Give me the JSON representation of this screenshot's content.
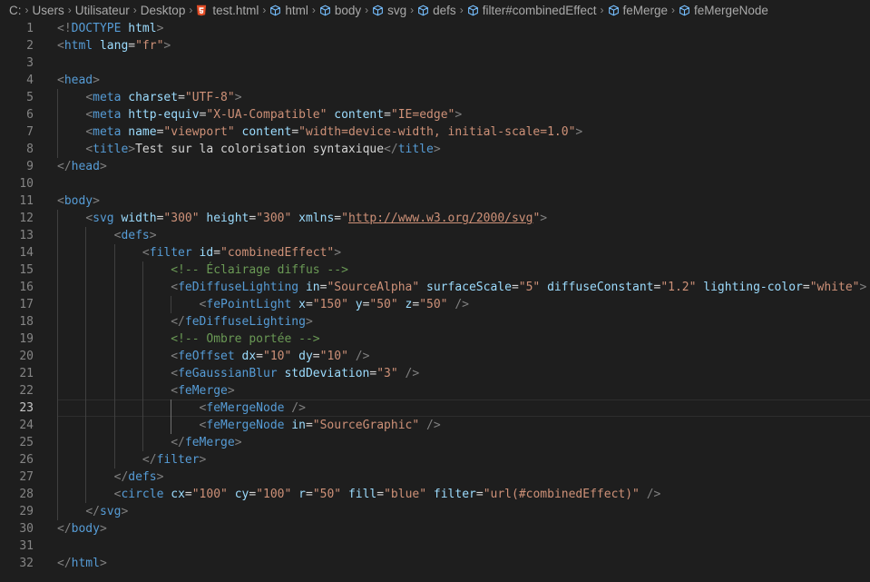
{
  "breadcrumb": {
    "items": [
      {
        "label": "C:",
        "icon": ""
      },
      {
        "label": "Users",
        "icon": ""
      },
      {
        "label": "Utilisateur",
        "icon": ""
      },
      {
        "label": "Desktop",
        "icon": ""
      },
      {
        "label": "test.html",
        "icon": "html5-icon"
      },
      {
        "label": "html",
        "icon": "cube-icon"
      },
      {
        "label": "body",
        "icon": "cube-icon"
      },
      {
        "label": "svg",
        "icon": "cube-icon"
      },
      {
        "label": "defs",
        "icon": "cube-icon"
      },
      {
        "label": "filter#combinedEffect",
        "icon": "cube-icon"
      },
      {
        "label": "feMerge",
        "icon": "cube-icon"
      },
      {
        "label": "feMergeNode",
        "icon": "cube-icon"
      }
    ]
  },
  "colors": {
    "background": "#1e1e1e",
    "bracket": "#808080",
    "tag": "#569cd6",
    "attribute": "#9cdcfe",
    "value": "#ce9178",
    "comment": "#6a9955",
    "html5_icon": "#e44d26"
  },
  "editor": {
    "active_line": 23,
    "lines": [
      {
        "n": "1",
        "indent": 0,
        "tokens": [
          [
            "b",
            "<!"
          ],
          [
            "t",
            "DOCTYPE"
          ],
          [
            "x",
            " "
          ],
          [
            "a",
            "html"
          ],
          [
            "b",
            ">"
          ]
        ]
      },
      {
        "n": "2",
        "indent": 0,
        "tokens": [
          [
            "b",
            "<"
          ],
          [
            "t",
            "html"
          ],
          [
            "x",
            " "
          ],
          [
            "a",
            "lang"
          ],
          [
            "x",
            "="
          ],
          [
            "v",
            "\"fr\""
          ],
          [
            "b",
            ">"
          ]
        ]
      },
      {
        "n": "3",
        "indent": 0,
        "tokens": []
      },
      {
        "n": "4",
        "indent": 0,
        "tokens": [
          [
            "b",
            "<"
          ],
          [
            "t",
            "head"
          ],
          [
            "b",
            ">"
          ]
        ]
      },
      {
        "n": "5",
        "indent": 1,
        "tokens": [
          [
            "b",
            "<"
          ],
          [
            "t",
            "meta"
          ],
          [
            "x",
            " "
          ],
          [
            "a",
            "charset"
          ],
          [
            "x",
            "="
          ],
          [
            "v",
            "\"UTF-8\""
          ],
          [
            "b",
            ">"
          ]
        ]
      },
      {
        "n": "6",
        "indent": 1,
        "tokens": [
          [
            "b",
            "<"
          ],
          [
            "t",
            "meta"
          ],
          [
            "x",
            " "
          ],
          [
            "a",
            "http-equiv"
          ],
          [
            "x",
            "="
          ],
          [
            "v",
            "\"X-UA-Compatible\""
          ],
          [
            "x",
            " "
          ],
          [
            "a",
            "content"
          ],
          [
            "x",
            "="
          ],
          [
            "v",
            "\"IE=edge\""
          ],
          [
            "b",
            ">"
          ]
        ]
      },
      {
        "n": "7",
        "indent": 1,
        "tokens": [
          [
            "b",
            "<"
          ],
          [
            "t",
            "meta"
          ],
          [
            "x",
            " "
          ],
          [
            "a",
            "name"
          ],
          [
            "x",
            "="
          ],
          [
            "v",
            "\"viewport\""
          ],
          [
            "x",
            " "
          ],
          [
            "a",
            "content"
          ],
          [
            "x",
            "="
          ],
          [
            "v",
            "\"width=device-width, initial-scale=1.0\""
          ],
          [
            "b",
            ">"
          ]
        ]
      },
      {
        "n": "8",
        "indent": 1,
        "tokens": [
          [
            "b",
            "<"
          ],
          [
            "t",
            "title"
          ],
          [
            "b",
            ">"
          ],
          [
            "x",
            "Test sur la colorisation syntaxique"
          ],
          [
            "b",
            "</"
          ],
          [
            "t",
            "title"
          ],
          [
            "b",
            ">"
          ]
        ]
      },
      {
        "n": "9",
        "indent": 0,
        "tokens": [
          [
            "b",
            "</"
          ],
          [
            "t",
            "head"
          ],
          [
            "b",
            ">"
          ]
        ]
      },
      {
        "n": "10",
        "indent": 0,
        "tokens": []
      },
      {
        "n": "11",
        "indent": 0,
        "tokens": [
          [
            "b",
            "<"
          ],
          [
            "t",
            "body"
          ],
          [
            "b",
            ">"
          ]
        ]
      },
      {
        "n": "12",
        "indent": 1,
        "tokens": [
          [
            "b",
            "<"
          ],
          [
            "t",
            "svg"
          ],
          [
            "x",
            " "
          ],
          [
            "a",
            "width"
          ],
          [
            "x",
            "="
          ],
          [
            "v",
            "\"300\""
          ],
          [
            "x",
            " "
          ],
          [
            "a",
            "height"
          ],
          [
            "x",
            "="
          ],
          [
            "v",
            "\"300\""
          ],
          [
            "x",
            " "
          ],
          [
            "a",
            "xmlns"
          ],
          [
            "x",
            "="
          ],
          [
            "v",
            "\""
          ],
          [
            "l",
            "http://www.w3.org/2000/svg"
          ],
          [
            "v",
            "\""
          ],
          [
            "b",
            ">"
          ]
        ]
      },
      {
        "n": "13",
        "indent": 2,
        "tokens": [
          [
            "b",
            "<"
          ],
          [
            "t",
            "defs"
          ],
          [
            "b",
            ">"
          ]
        ]
      },
      {
        "n": "14",
        "indent": 3,
        "tokens": [
          [
            "b",
            "<"
          ],
          [
            "t",
            "filter"
          ],
          [
            "x",
            " "
          ],
          [
            "a",
            "id"
          ],
          [
            "x",
            "="
          ],
          [
            "v",
            "\"combinedEffect\""
          ],
          [
            "b",
            ">"
          ]
        ]
      },
      {
        "n": "15",
        "indent": 4,
        "tokens": [
          [
            "c",
            "<!-- Éclairage diffus -->"
          ]
        ]
      },
      {
        "n": "16",
        "indent": 4,
        "tokens": [
          [
            "b",
            "<"
          ],
          [
            "t",
            "feDiffuseLighting"
          ],
          [
            "x",
            " "
          ],
          [
            "a",
            "in"
          ],
          [
            "x",
            "="
          ],
          [
            "v",
            "\"SourceAlpha\""
          ],
          [
            "x",
            " "
          ],
          [
            "a",
            "surfaceScale"
          ],
          [
            "x",
            "="
          ],
          [
            "v",
            "\"5\""
          ],
          [
            "x",
            " "
          ],
          [
            "a",
            "diffuseConstant"
          ],
          [
            "x",
            "="
          ],
          [
            "v",
            "\"1.2\""
          ],
          [
            "x",
            " "
          ],
          [
            "a",
            "lighting-color"
          ],
          [
            "x",
            "="
          ],
          [
            "v",
            "\"white\""
          ],
          [
            "b",
            ">"
          ]
        ]
      },
      {
        "n": "17",
        "indent": 5,
        "tokens": [
          [
            "b",
            "<"
          ],
          [
            "t",
            "fePointLight"
          ],
          [
            "x",
            " "
          ],
          [
            "a",
            "x"
          ],
          [
            "x",
            "="
          ],
          [
            "v",
            "\"150\""
          ],
          [
            "x",
            " "
          ],
          [
            "a",
            "y"
          ],
          [
            "x",
            "="
          ],
          [
            "v",
            "\"50\""
          ],
          [
            "x",
            " "
          ],
          [
            "a",
            "z"
          ],
          [
            "x",
            "="
          ],
          [
            "v",
            "\"50\""
          ],
          [
            "x",
            " "
          ],
          [
            "b",
            "/>"
          ]
        ]
      },
      {
        "n": "18",
        "indent": 4,
        "tokens": [
          [
            "b",
            "</"
          ],
          [
            "t",
            "feDiffuseLighting"
          ],
          [
            "b",
            ">"
          ]
        ]
      },
      {
        "n": "19",
        "indent": 4,
        "tokens": [
          [
            "c",
            "<!-- Ombre portée -->"
          ]
        ]
      },
      {
        "n": "20",
        "indent": 4,
        "tokens": [
          [
            "b",
            "<"
          ],
          [
            "t",
            "feOffset"
          ],
          [
            "x",
            " "
          ],
          [
            "a",
            "dx"
          ],
          [
            "x",
            "="
          ],
          [
            "v",
            "\"10\""
          ],
          [
            "x",
            " "
          ],
          [
            "a",
            "dy"
          ],
          [
            "x",
            "="
          ],
          [
            "v",
            "\"10\""
          ],
          [
            "x",
            " "
          ],
          [
            "b",
            "/>"
          ]
        ]
      },
      {
        "n": "21",
        "indent": 4,
        "tokens": [
          [
            "b",
            "<"
          ],
          [
            "t",
            "feGaussianBlur"
          ],
          [
            "x",
            " "
          ],
          [
            "a",
            "stdDeviation"
          ],
          [
            "x",
            "="
          ],
          [
            "v",
            "\"3\""
          ],
          [
            "x",
            " "
          ],
          [
            "b",
            "/>"
          ]
        ]
      },
      {
        "n": "22",
        "indent": 4,
        "tokens": [
          [
            "b",
            "<"
          ],
          [
            "t",
            "feMerge"
          ],
          [
            "b",
            ">"
          ]
        ]
      },
      {
        "n": "23",
        "indent": 5,
        "tokens": [
          [
            "b",
            "<"
          ],
          [
            "t",
            "feMergeNode"
          ],
          [
            "x",
            " "
          ],
          [
            "b",
            "/>"
          ]
        ]
      },
      {
        "n": "24",
        "indent": 5,
        "tokens": [
          [
            "b",
            "<"
          ],
          [
            "t",
            "feMergeNode"
          ],
          [
            "x",
            " "
          ],
          [
            "a",
            "in"
          ],
          [
            "x",
            "="
          ],
          [
            "v",
            "\"SourceGraphic\""
          ],
          [
            "x",
            " "
          ],
          [
            "b",
            "/>"
          ]
        ]
      },
      {
        "n": "25",
        "indent": 4,
        "tokens": [
          [
            "b",
            "</"
          ],
          [
            "t",
            "feMerge"
          ],
          [
            "b",
            ">"
          ]
        ]
      },
      {
        "n": "26",
        "indent": 3,
        "tokens": [
          [
            "b",
            "</"
          ],
          [
            "t",
            "filter"
          ],
          [
            "b",
            ">"
          ]
        ]
      },
      {
        "n": "27",
        "indent": 2,
        "tokens": [
          [
            "b",
            "</"
          ],
          [
            "t",
            "defs"
          ],
          [
            "b",
            ">"
          ]
        ]
      },
      {
        "n": "28",
        "indent": 2,
        "tokens": [
          [
            "b",
            "<"
          ],
          [
            "t",
            "circle"
          ],
          [
            "x",
            " "
          ],
          [
            "a",
            "cx"
          ],
          [
            "x",
            "="
          ],
          [
            "v",
            "\"100\""
          ],
          [
            "x",
            " "
          ],
          [
            "a",
            "cy"
          ],
          [
            "x",
            "="
          ],
          [
            "v",
            "\"100\""
          ],
          [
            "x",
            " "
          ],
          [
            "a",
            "r"
          ],
          [
            "x",
            "="
          ],
          [
            "v",
            "\"50\""
          ],
          [
            "x",
            " "
          ],
          [
            "a",
            "fill"
          ],
          [
            "x",
            "="
          ],
          [
            "v",
            "\"blue\""
          ],
          [
            "x",
            " "
          ],
          [
            "a",
            "filter"
          ],
          [
            "x",
            "="
          ],
          [
            "v",
            "\"url(#combinedEffect)\""
          ],
          [
            "x",
            " "
          ],
          [
            "b",
            "/>"
          ]
        ]
      },
      {
        "n": "29",
        "indent": 1,
        "tokens": [
          [
            "b",
            "</"
          ],
          [
            "t",
            "svg"
          ],
          [
            "b",
            ">"
          ]
        ]
      },
      {
        "n": "30",
        "indent": 0,
        "tokens": [
          [
            "b",
            "</"
          ],
          [
            "t",
            "body"
          ],
          [
            "b",
            ">"
          ]
        ]
      },
      {
        "n": "31",
        "indent": 0,
        "tokens": []
      },
      {
        "n": "32",
        "indent": 0,
        "tokens": [
          [
            "b",
            "</"
          ],
          [
            "t",
            "html"
          ],
          [
            "b",
            ">"
          ]
        ]
      }
    ]
  }
}
